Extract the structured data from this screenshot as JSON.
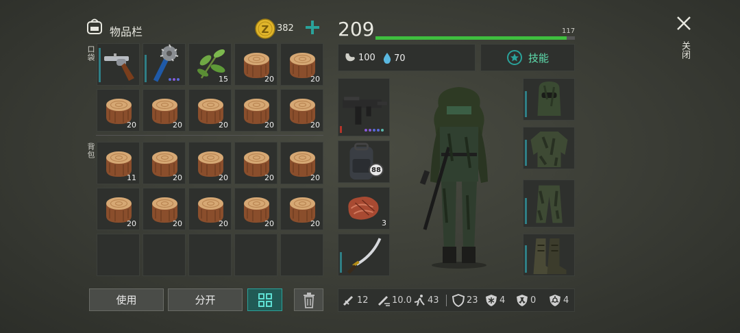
{
  "header": {
    "title": "物品栏",
    "coins": "382",
    "hp_value": "209",
    "hp_max": "117",
    "hp_fill_fraction": 0.96
  },
  "sections": {
    "pocket": "口袋",
    "backpack": "背包"
  },
  "pocket_slots": [
    {
      "icon": "revolver-icon",
      "count": ""
    },
    {
      "icon": "spiked-club-icon",
      "count": ""
    },
    {
      "icon": "plant-leaves-icon",
      "count": "15"
    },
    {
      "icon": "wood-log-icon",
      "count": "20"
    },
    {
      "icon": "wood-log-icon",
      "count": "20"
    },
    {
      "icon": "wood-log-icon",
      "count": "20"
    },
    {
      "icon": "wood-log-icon",
      "count": "20"
    },
    {
      "icon": "wood-log-icon",
      "count": "20"
    },
    {
      "icon": "wood-log-icon",
      "count": "20"
    },
    {
      "icon": "wood-log-icon",
      "count": "20"
    }
  ],
  "backpack_slots": [
    {
      "icon": "wood-log-icon",
      "count": "11"
    },
    {
      "icon": "wood-log-icon",
      "count": "20"
    },
    {
      "icon": "wood-log-icon",
      "count": "20"
    },
    {
      "icon": "wood-log-icon",
      "count": "20"
    },
    {
      "icon": "wood-log-icon",
      "count": "20"
    },
    {
      "icon": "wood-log-icon",
      "count": "20"
    },
    {
      "icon": "wood-log-icon",
      "count": "20"
    },
    {
      "icon": "wood-log-icon",
      "count": "20"
    },
    {
      "icon": "wood-log-icon",
      "count": "20"
    },
    {
      "icon": "wood-log-icon",
      "count": "20"
    },
    {
      "icon": "",
      "count": ""
    },
    {
      "icon": "",
      "count": ""
    },
    {
      "icon": "",
      "count": ""
    },
    {
      "icon": "",
      "count": ""
    },
    {
      "icon": "",
      "count": ""
    }
  ],
  "buttons": {
    "use": "使用",
    "split": "分开",
    "skills": "技能",
    "close": "关闭"
  },
  "vitals": {
    "hunger": "100",
    "thirst": "70"
  },
  "equipment_left": [
    {
      "icon": "smg-icon",
      "count": ""
    },
    {
      "icon": "backpack-icon",
      "count": "",
      "badge": "88"
    },
    {
      "icon": "steak-icon",
      "count": "3"
    },
    {
      "icon": "katana-icon",
      "count": ""
    }
  ],
  "equipment_right": [
    {
      "icon": "balaclava-icon"
    },
    {
      "icon": "camo-jacket-icon"
    },
    {
      "icon": "camo-pants-icon"
    },
    {
      "icon": "boots-icon"
    }
  ],
  "stats": [
    {
      "icon": "melee-damage-icon",
      "value": "12"
    },
    {
      "icon": "attack-speed-icon",
      "value": "10.0"
    },
    {
      "icon": "move-speed-icon",
      "value": "43"
    },
    {
      "icon": "armor-icon",
      "value": "23"
    },
    {
      "icon": "cold-resist-icon",
      "value": "4"
    },
    {
      "icon": "radiation-resist-icon",
      "value": "0"
    },
    {
      "icon": "toxic-resist-icon",
      "value": "4"
    }
  ],
  "colors": {
    "accent_teal": "#2aa39b",
    "hp_green": "#3fbf3f",
    "coin_gold": "#e0b52a",
    "durability_teal": "#2f7f86",
    "durability_red": "#b5342a"
  }
}
